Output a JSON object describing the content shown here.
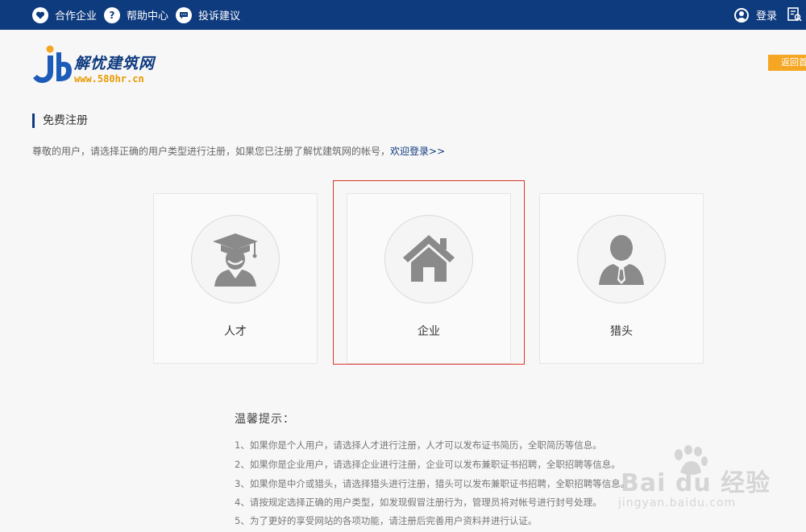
{
  "topbar": {
    "partner": "合作企业",
    "help": "帮助中心",
    "complaint": "投诉建议",
    "login": "登录"
  },
  "logo": {
    "name": "解忧建筑网",
    "url": "www.580hr.cn"
  },
  "back_button": "返回首页",
  "section": {
    "title": "免费注册",
    "intro": "尊敬的用户，请选择正确的用户类型进行注册，如果您已注册了解忧建筑网的帐号，",
    "login_link": "欢迎登录>>"
  },
  "cards": [
    {
      "label": "人才",
      "icon": "graduate-icon"
    },
    {
      "label": "企业",
      "icon": "house-icon"
    },
    {
      "label": "猎头",
      "icon": "businessman-icon"
    }
  ],
  "tips": {
    "title": "温馨提示：",
    "items": [
      "1、如果你是个人用户，请选择人才进行注册，人才可以发布证书简历，全职简历等信息。",
      "2、如果你是企业用户，请选择企业进行注册，企业可以发布兼职证书招聘，全职招聘等信息。",
      "3、如果你是中介或猎头，请选择猎头进行注册，猎头可以发布兼职证书招聘，全职招聘等信息。",
      "4、请按规定选择正确的用户类型，如发现假冒注册行为，管理员将对帐号进行封号处理。",
      "5、为了更好的享受网站的各项功能，请注册后完善用户资料并进行认证。"
    ]
  },
  "watermark": {
    "brand": "Bai du 经验",
    "url": "jingyan.baidu.com"
  },
  "colors": {
    "topbar": "#0e3a7e",
    "accent_orange": "#f5a623",
    "highlight_red": "#d9352a",
    "icon_gray": "#8a8a8a"
  }
}
